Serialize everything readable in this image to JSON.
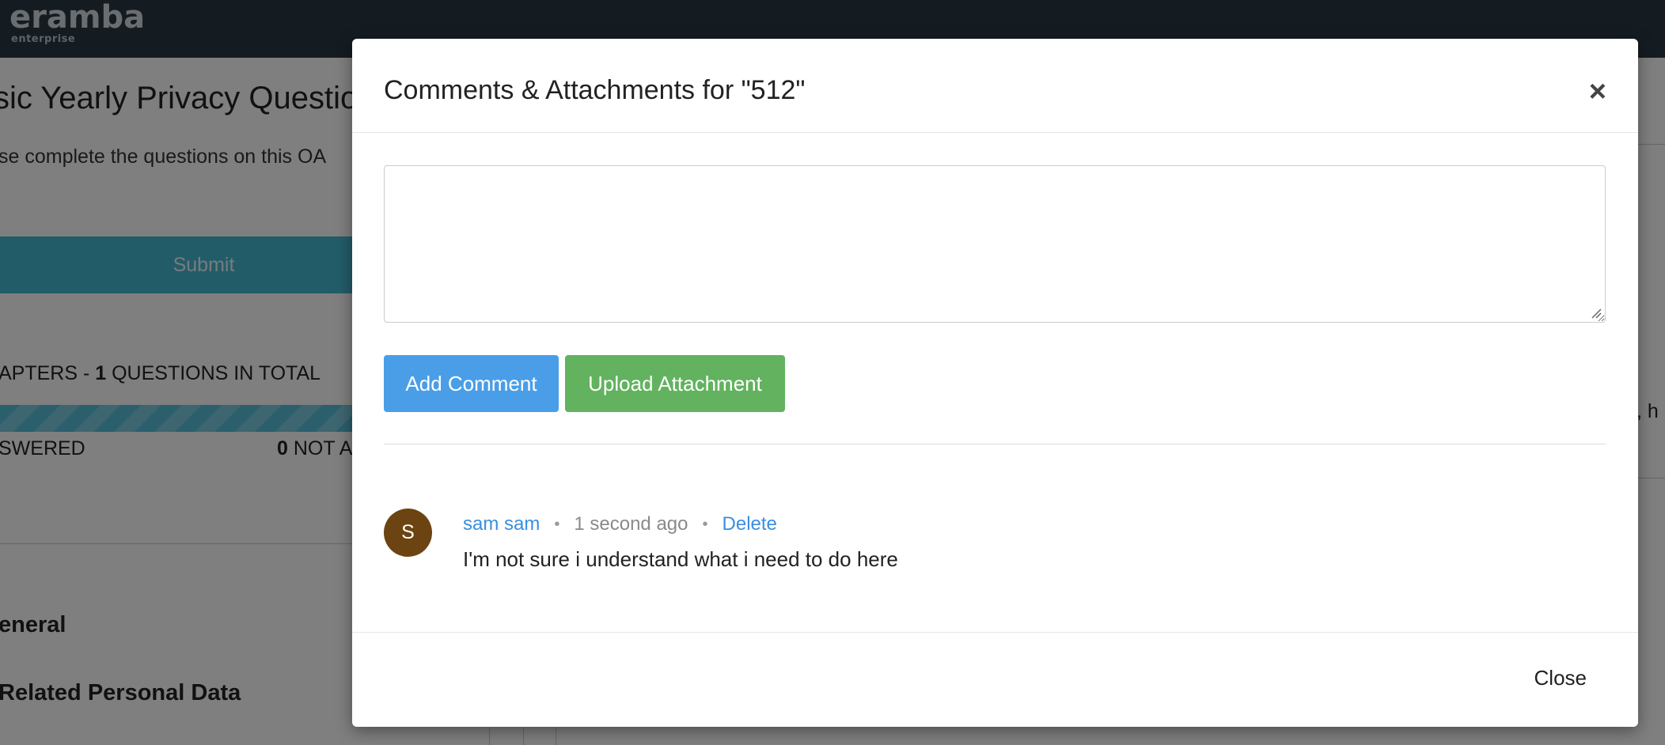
{
  "background": {
    "logo": "eramba",
    "logo_sub": "enterprise",
    "title": "sic Yearly Privacy Questio",
    "subtitle": "se complete the questions on this OA",
    "submit_label": "Submit",
    "chapters_prefix": "APTERS - ",
    "chapters_count": "1",
    "chapters_suffix": " QUESTIONS IN TOTAL",
    "answered_label": "SWERED",
    "not_answered_count": "0",
    "not_answered_label": " NOT A",
    "section_general": "eneral",
    "section_related": "Related Personal Data",
    "right_edge_text": ", h"
  },
  "modal": {
    "title": "Comments & Attachments for \"512\"",
    "close_x": "×",
    "comment_value": "",
    "add_comment_label": "Add Comment",
    "upload_attachment_label": "Upload Attachment",
    "comments": [
      {
        "avatar_initial": "S",
        "author": "sam sam",
        "time": "1 second ago",
        "delete_label": "Delete",
        "text": "I'm not sure i understand what i need to do here"
      }
    ],
    "footer_close_label": "Close"
  },
  "colors": {
    "topbar": "#2a3942",
    "primary": "#4a9ee8",
    "success": "#62b25f",
    "avatar": "#6b4411",
    "link": "#3a8ee0",
    "submit_bg": "#47b8d3"
  }
}
